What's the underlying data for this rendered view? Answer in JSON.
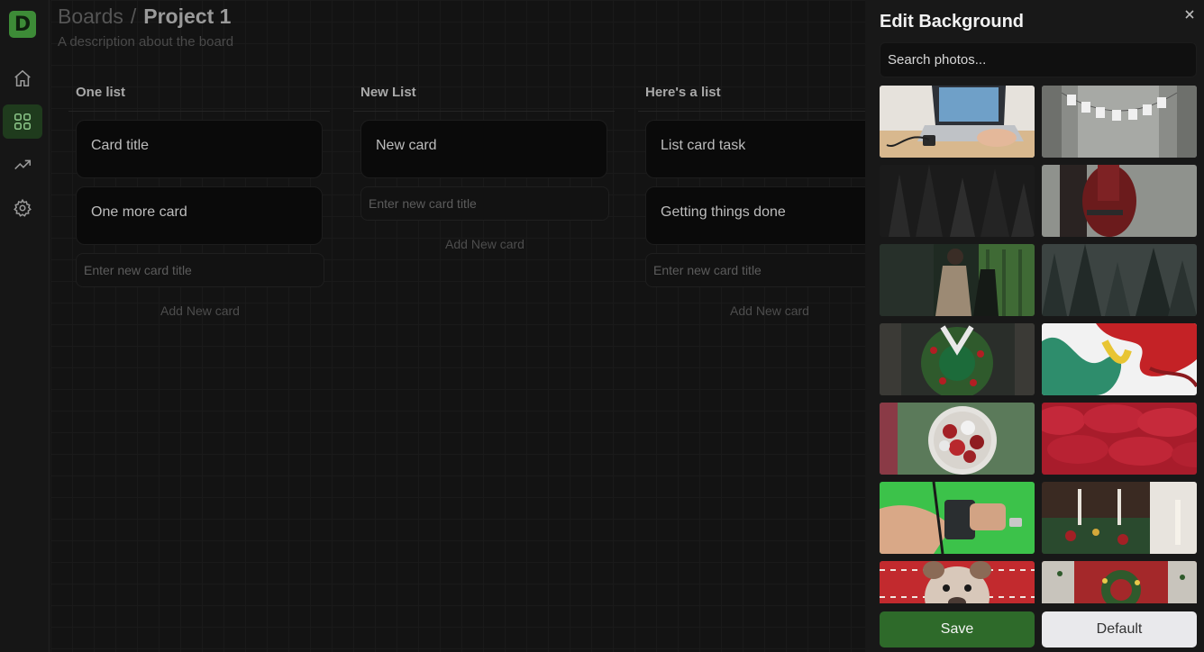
{
  "logo": {
    "letter": "D",
    "color": "#3d8b37"
  },
  "sidebar": {
    "items": [
      {
        "icon": "home-icon",
        "active": false
      },
      {
        "icon": "boards-grid-icon",
        "active": true
      },
      {
        "icon": "trending-up-icon",
        "active": false
      },
      {
        "icon": "gear-icon",
        "active": false
      }
    ]
  },
  "header": {
    "crumb_root": "Boards",
    "separator": "/",
    "title": "Project 1",
    "description": "A description about the board"
  },
  "lists": [
    {
      "title": "One list",
      "cards": [
        "Card title",
        "One more card"
      ],
      "input_placeholder": "Enter new card title",
      "add_label": "Add New card"
    },
    {
      "title": "New List",
      "cards": [
        "New card"
      ],
      "input_placeholder": "Enter new card title",
      "add_label": "Add New card"
    },
    {
      "title": "Here's a list",
      "cards": [
        "List card task",
        "Getting things done"
      ],
      "input_placeholder": "Enter new card title",
      "add_label": "Add New card"
    }
  ],
  "panel": {
    "title": "Edit Background",
    "close_icon": "close-icon",
    "search_placeholder": "Search photos...",
    "photos": [
      "laptop-desk-photo",
      "snow-garland-photo",
      "dark-forest-photo",
      "red-dress-couple-photo",
      "woman-trench-coat-photo",
      "misty-forest-photo",
      "christmas-wreath-photo",
      "paint-swirl-photo",
      "ornament-bowl-photo",
      "red-foliage-photo",
      "green-shirt-hands-photo",
      "candles-table-photo",
      "dog-sweater-photo",
      "red-door-wreath-photo"
    ],
    "save_label": "Save",
    "default_label": "Default"
  },
  "colors": {
    "accent": "#2e6a2a",
    "active_nav": "#1f3b1d",
    "background": "#121212"
  }
}
